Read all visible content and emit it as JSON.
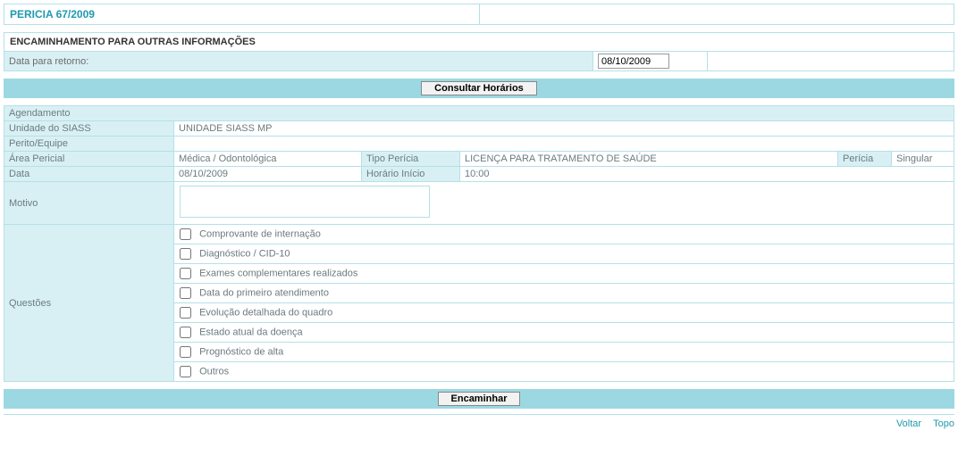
{
  "header": {
    "title": "PERICIA 67/2009"
  },
  "section": {
    "title": "ENCAMINHAMENTO PARA OUTRAS INFORMAÇÕES"
  },
  "retorno": {
    "label": "Data para retorno:",
    "value": "08/10/2009"
  },
  "buttons": {
    "consultar": "Consultar Horários",
    "encaminhar": "Encaminhar"
  },
  "agendamento": {
    "heading": "Agendamento",
    "unidade_label": "Unidade do SIASS",
    "unidade_value": "UNIDADE SIASS MP",
    "perito_label": "Perito/Equipe",
    "perito_value": "",
    "area_label": "Área Pericial",
    "area_value": "Médica / Odontológica",
    "tipo_label": "Tipo Perícia",
    "tipo_value": "LICENÇA PARA TRATAMENTO DE SAÚDE",
    "pericia_label": "Perícia",
    "pericia_value": "Singular",
    "data_label": "Data",
    "data_value": "08/10/2009",
    "horario_label": "Horário Início",
    "horario_value": "10:00",
    "motivo_label": "Motivo",
    "motivo_value": ""
  },
  "questoes": {
    "label": "Questões",
    "items": [
      "Comprovante de internação",
      "Diagnóstico / CID-10",
      "Exames complementares realizados",
      "Data do primeiro atendimento",
      "Evolução detalhada do quadro",
      "Estado atual da doença",
      "Prognóstico de alta",
      "Outros"
    ]
  },
  "footer": {
    "voltar": "Voltar",
    "topo": "Topo"
  }
}
